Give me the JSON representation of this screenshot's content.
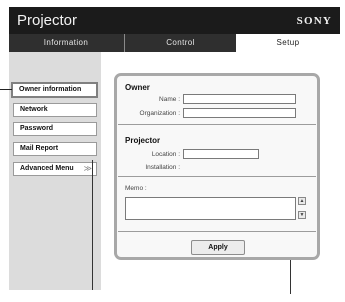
{
  "header": {
    "title": "Projector",
    "brand": "SONY"
  },
  "tabs": [
    {
      "label": "Information"
    },
    {
      "label": "Control"
    },
    {
      "label": "Setup"
    }
  ],
  "sidebar": {
    "items": [
      {
        "label": "Owner information"
      },
      {
        "label": "Network"
      },
      {
        "label": "Password"
      },
      {
        "label": "Mail Report"
      },
      {
        "label": "Advanced Menu",
        "chevron": "≫"
      }
    ]
  },
  "owner": {
    "title": "Owner",
    "name_label": "Name :",
    "name_value": "",
    "org_label": "Organization :",
    "org_value": ""
  },
  "projector": {
    "title": "Projector",
    "location_label": "Location :",
    "location_value": "",
    "installation_label": "Installation :"
  },
  "memo": {
    "label": "Memo :",
    "value": ""
  },
  "actions": {
    "apply_label": "Apply"
  },
  "colors": {
    "header_bg": "#1b1b1b",
    "tabbar_bg": "#2f2f2f",
    "sidebar_bg": "#dcdcdc",
    "panel_border": "#a8a8a8"
  }
}
